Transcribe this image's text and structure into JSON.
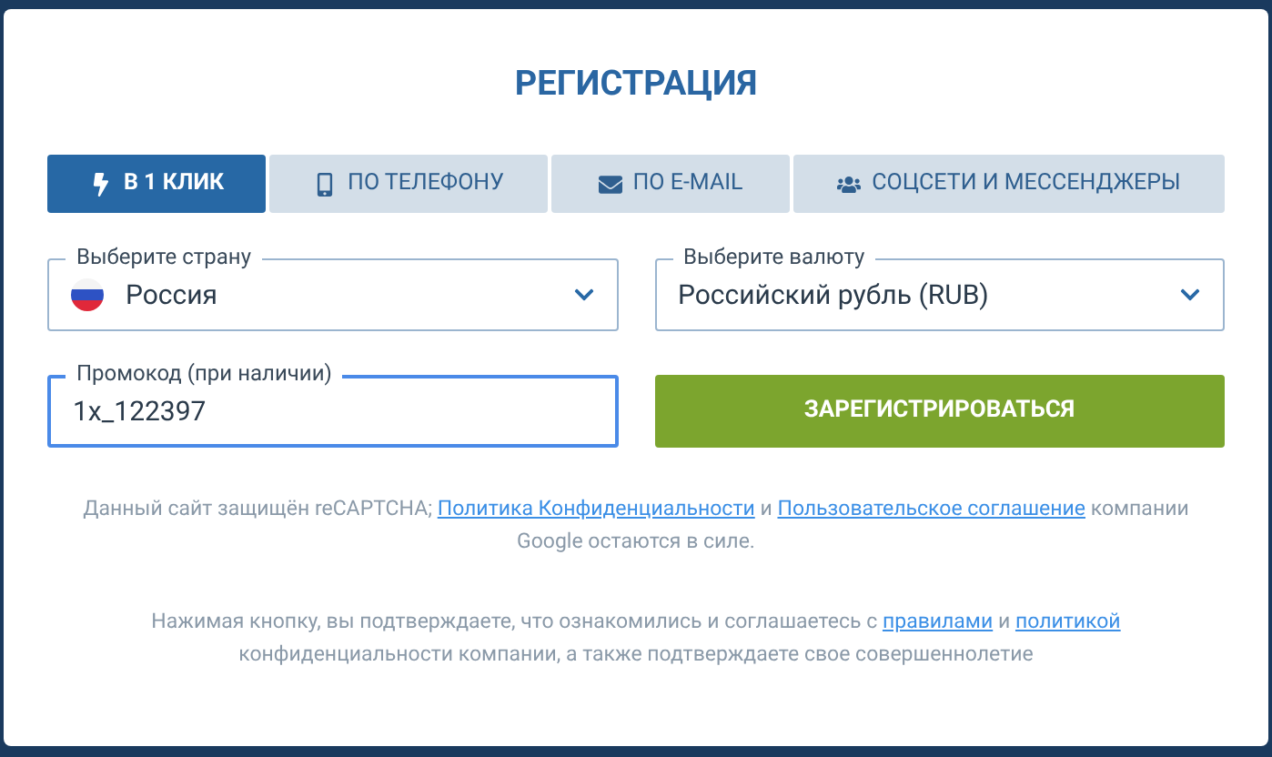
{
  "title": "РЕГИСТРАЦИЯ",
  "tabs": [
    {
      "label": "В 1 КЛИК",
      "selected": true
    },
    {
      "label": "ПО ТЕЛЕФОНУ",
      "selected": false
    },
    {
      "label": "ПО E-MAIL",
      "selected": false
    },
    {
      "label": "СОЦСЕТИ И МЕССЕНДЖЕРЫ",
      "selected": false
    }
  ],
  "country": {
    "label": "Выберите страну",
    "value": "Россия"
  },
  "currency": {
    "label": "Выберите валюту",
    "value": "Российский рубль (RUB)"
  },
  "promo": {
    "label": "Промокод (при наличии)",
    "value": "1x_122397",
    "focused": true
  },
  "register_button": "ЗАРЕГИСТРИРОВАТЬСЯ",
  "notes": [
    [
      {
        "kind": "text",
        "text": "Данный сайт защищён reCAPTCHA;"
      },
      {
        "kind": "link",
        "text": "Политика Конфиденциальности"
      },
      {
        "kind": "text",
        "text": "и"
      },
      {
        "kind": "link",
        "text": "Пользовательское соглашение"
      },
      {
        "kind": "text",
        "text": "компании Google остаются в силе."
      }
    ],
    [
      {
        "kind": "text",
        "text": "Нажимая кнопку, вы подтверждаете, что ознакомились и соглашаетесь с"
      },
      {
        "kind": "link",
        "text": "правилами"
      },
      {
        "kind": "text",
        "text": "и"
      },
      {
        "kind": "link",
        "text": "политикой"
      },
      {
        "kind": "text",
        "text": "конфиденциальности компании, а также подтверждаете свое совершеннолетие"
      }
    ]
  ]
}
